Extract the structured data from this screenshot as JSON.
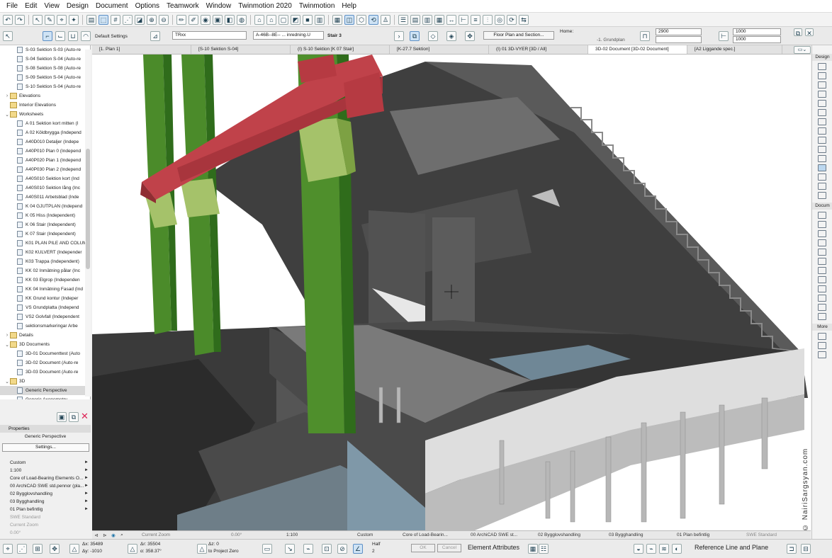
{
  "menu": [
    "File",
    "Edit",
    "View",
    "Design",
    "Document",
    "Options",
    "Teamwork",
    "Window",
    "Twinmotion 2020",
    "Twinmotion",
    "Help"
  ],
  "infobox": {
    "settings_label": "Default Settings",
    "id_value": "TRxx",
    "layer_value": "A-46B--8E-- ... inredning.U",
    "story_label": "Stair 3",
    "plan_button": "Floor Plan and Section...",
    "home_label": "Home:",
    "home_value": "-1. Grundplan",
    "height_value": "2900",
    "width_a": "1000",
    "width_b": "1000"
  },
  "tabs": [
    "[1. Plan 1]",
    "[S-10 Sektion S-04]",
    "(I) S-10 Sektion [K 07 Stair]",
    "[K-27.7 Sektion]",
    "(I) 01 3D-VYER [3D / All]",
    "3D-02 Document [3D-02 Document]",
    "[A2 Liggande spec.]"
  ],
  "navigator": {
    "items": [
      {
        "label": "S-03 Sektion S-03 (Auto-re",
        "indent": 3,
        "kind": "doc"
      },
      {
        "label": "S-04 Sektion S-04 (Auto-re",
        "indent": 3,
        "kind": "doc"
      },
      {
        "label": "S-08 Sektion S-08 (Auto-re",
        "indent": 3,
        "kind": "doc"
      },
      {
        "label": "S-09 Sektion S-04 (Auto-re",
        "indent": 3,
        "kind": "doc"
      },
      {
        "label": "S-10 Sektion S-04 (Auto-re",
        "indent": 3,
        "kind": "doc"
      },
      {
        "label": "Elevations",
        "indent": 1,
        "kind": "folder",
        "chev": "›"
      },
      {
        "label": "Interior Elevations",
        "indent": 1,
        "kind": "folder",
        "chev": ""
      },
      {
        "label": "Worksheets",
        "indent": 1,
        "kind": "folder",
        "chev": "⌄"
      },
      {
        "label": "A 01 Sektion kort mitten (I",
        "indent": 3,
        "kind": "doc"
      },
      {
        "label": "A 02 Köldbrygga (Independ",
        "indent": 3,
        "kind": "doc"
      },
      {
        "label": "A40D010 Detaljer (Indepe",
        "indent": 3,
        "kind": "doc"
      },
      {
        "label": "A40P010 Plan 0 (Independ",
        "indent": 3,
        "kind": "doc"
      },
      {
        "label": "A40P020 Plan 1 (Independ",
        "indent": 3,
        "kind": "doc"
      },
      {
        "label": "A40P030 Plan 2 (Independ",
        "indent": 3,
        "kind": "doc"
      },
      {
        "label": "A40S010 Sektion kort (Ind",
        "indent": 3,
        "kind": "doc"
      },
      {
        "label": "A40S010 Sektion lång (Inc",
        "indent": 3,
        "kind": "doc"
      },
      {
        "label": "A40S011 Arbetsblad (Inde",
        "indent": 3,
        "kind": "doc"
      },
      {
        "label": "K 04 GJUTPLAN (Independ",
        "indent": 3,
        "kind": "doc"
      },
      {
        "label": "K 05 Hiss (Independent)",
        "indent": 3,
        "kind": "doc"
      },
      {
        "label": "K 06 Stair (Independent)",
        "indent": 3,
        "kind": "doc"
      },
      {
        "label": "K 07 Stair (Independent)",
        "indent": 3,
        "kind": "doc"
      },
      {
        "label": "K01 PLAN PILE AND COLUM",
        "indent": 3,
        "kind": "doc"
      },
      {
        "label": "K02 KULVERT (Independer",
        "indent": 3,
        "kind": "doc"
      },
      {
        "label": "K03 Trappa (Independent)",
        "indent": 3,
        "kind": "doc"
      },
      {
        "label": "KK 02 Inmätning pålar (Inc",
        "indent": 3,
        "kind": "doc"
      },
      {
        "label": "KK 03 Elgrop (Independen",
        "indent": 3,
        "kind": "doc"
      },
      {
        "label": "KK 04 Inmätning Fasad (Ind",
        "indent": 3,
        "kind": "doc"
      },
      {
        "label": "KK Grund kontur (Indeper",
        "indent": 3,
        "kind": "doc"
      },
      {
        "label": "VS Grundplatta (Independ",
        "indent": 3,
        "kind": "doc"
      },
      {
        "label": "VS2 Golvfall (Independent",
        "indent": 3,
        "kind": "doc"
      },
      {
        "label": "sektionsmarkeringar Arbe",
        "indent": 3,
        "kind": "doc"
      },
      {
        "label": "Details",
        "indent": 1,
        "kind": "folder",
        "chev": "›"
      },
      {
        "label": "3D Documents",
        "indent": 1,
        "kind": "folder",
        "chev": "⌄"
      },
      {
        "label": "3D-01 Documenttest (Auto",
        "indent": 3,
        "kind": "doc"
      },
      {
        "label": "3D-02 Document (Auto-re",
        "indent": 3,
        "kind": "doc"
      },
      {
        "label": "3D-03 Document (Auto-re",
        "indent": 3,
        "kind": "doc"
      },
      {
        "label": "3D",
        "indent": 1,
        "kind": "folder",
        "chev": "⌄"
      },
      {
        "label": "Generic Perspective",
        "indent": 3,
        "kind": "doc",
        "selected": true
      },
      {
        "label": "Generic Axonometry",
        "indent": 3,
        "kind": "doc"
      }
    ]
  },
  "properties": {
    "header": "Properties",
    "name": "Generic Perspective",
    "settings_button": "Settings...",
    "rows": [
      {
        "label": "Custom",
        "dim": false
      },
      {
        "label": "1:100",
        "dim": false
      },
      {
        "label": "Core of Load-Bearing Elements O...",
        "dim": false
      },
      {
        "label": "00 ArchiCAD SWE std.pennor (pla...",
        "dim": false
      },
      {
        "label": "02 Bygglovshandling",
        "dim": false
      },
      {
        "label": "03 Bygghandling",
        "dim": false
      },
      {
        "label": "01 Plan befintlig",
        "dim": false
      },
      {
        "label": "SWE Standard",
        "dim": true
      },
      {
        "label": "Current Zoom",
        "dim": true
      },
      {
        "label": "0.00°",
        "dim": true
      }
    ]
  },
  "statusbar": {
    "zoom": "Current Zoom",
    "angle": "0.00°",
    "scale": "1:100",
    "custom": "Custom",
    "structure": "Core of Load-Bearin...",
    "pen": "00 ArchiCAD SWE st...",
    "lock1": "02 Bygglovshandling",
    "lock2": "03 Bygghandling",
    "lock3": "01 Plan befintlig",
    "renov": "SWE Standard"
  },
  "coordbar": {
    "dx": "Δx: 35489",
    "dy": "Δy: -1010",
    "dr": "Δr: 35504",
    "da": "α: 358.37°",
    "dz": "Δz: 0",
    "ref": "to Project Zero",
    "half": "Half",
    "half_n": "2",
    "ok": "OK",
    "cancel": "Cancel",
    "attr": "Element Attributes",
    "refline": "Reference Line and Plane"
  },
  "rightbar": {
    "design": "Design",
    "docum": "Docum",
    "more": "More"
  },
  "watermark": "© NairiSargsyan.com"
}
